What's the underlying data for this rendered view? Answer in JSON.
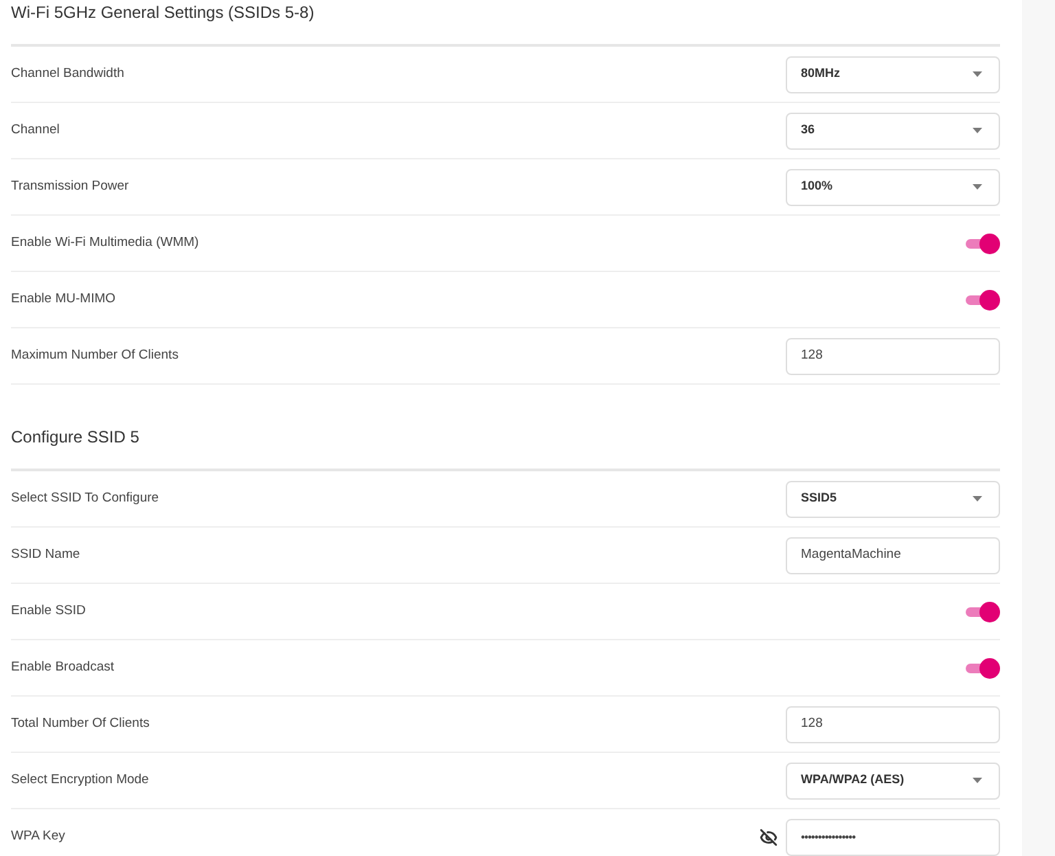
{
  "sections": [
    {
      "title": "Wi-Fi 5GHz General Settings (SSIDs 5-8)",
      "rows": [
        {
          "kind": "select",
          "label": "Channel Bandwidth",
          "value": "80MHz"
        },
        {
          "kind": "select",
          "label": "Channel",
          "value": "36"
        },
        {
          "kind": "select",
          "label": "Transmission Power",
          "value": "100%"
        },
        {
          "kind": "toggle",
          "label": "Enable Wi-Fi Multimedia (WMM)",
          "on": true
        },
        {
          "kind": "toggle",
          "label": "Enable MU-MIMO",
          "on": true
        },
        {
          "kind": "input",
          "label": "Maximum Number Of Clients",
          "value": "128"
        }
      ]
    },
    {
      "title": "Configure SSID 5",
      "rows": [
        {
          "kind": "select",
          "label": "Select SSID To Configure",
          "value": "SSID5"
        },
        {
          "kind": "input",
          "label": "SSID Name",
          "value": "MagentaMachine"
        },
        {
          "kind": "toggle",
          "label": "Enable SSID",
          "on": true
        },
        {
          "kind": "toggle",
          "label": "Enable Broadcast",
          "on": true
        },
        {
          "kind": "input",
          "label": "Total Number Of Clients",
          "value": "128"
        },
        {
          "kind": "select",
          "label": "Select Encryption Mode",
          "value": "WPA/WPA2 (AES)"
        },
        {
          "kind": "password",
          "label": "WPA Key",
          "value": "••••••••••••••••"
        }
      ]
    }
  ]
}
